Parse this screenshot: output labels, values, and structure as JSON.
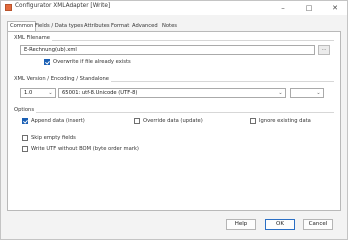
{
  "window": {
    "title": "Configurator XMLAdapter [Write]",
    "controls": {
      "minimize": "–",
      "maximize": "□",
      "close": "✕"
    }
  },
  "tabs": [
    {
      "label": "Common"
    },
    {
      "label": "Fields / Data types"
    },
    {
      "label": "Attributes"
    },
    {
      "label": "Format"
    },
    {
      "label": "Advanced"
    },
    {
      "label": "Notes"
    }
  ],
  "xml_filename": {
    "group_label": "XML Filename",
    "value": "E-Rechnung(ub).xml",
    "browse_label": "...",
    "overwrite_label": "Overwrite if file already exists",
    "overwrite_checked": true
  },
  "encoding": {
    "group_label": "XML Version / Encoding / Standalone",
    "version": "1.0",
    "encoding": "65001: utf-8.Unicode (UTF-8)",
    "standalone": ""
  },
  "options": {
    "group_label": "Options",
    "append_label": "Append data (insert)",
    "append_checked": true,
    "override_label": "Override data (update)",
    "override_checked": false,
    "ignore_label": "Ignore existing data",
    "ignore_checked": false,
    "skip_label": "Skip empty fields",
    "skip_checked": false,
    "utf8_label": "Write UTF without BOM (byte order mark)",
    "utf8_checked": false
  },
  "buttons": {
    "help": "Help",
    "ok": "OK",
    "cancel": "Cancel"
  },
  "colors": {
    "accent": "#1a5fb4",
    "app_icon": "#e46a3c"
  }
}
